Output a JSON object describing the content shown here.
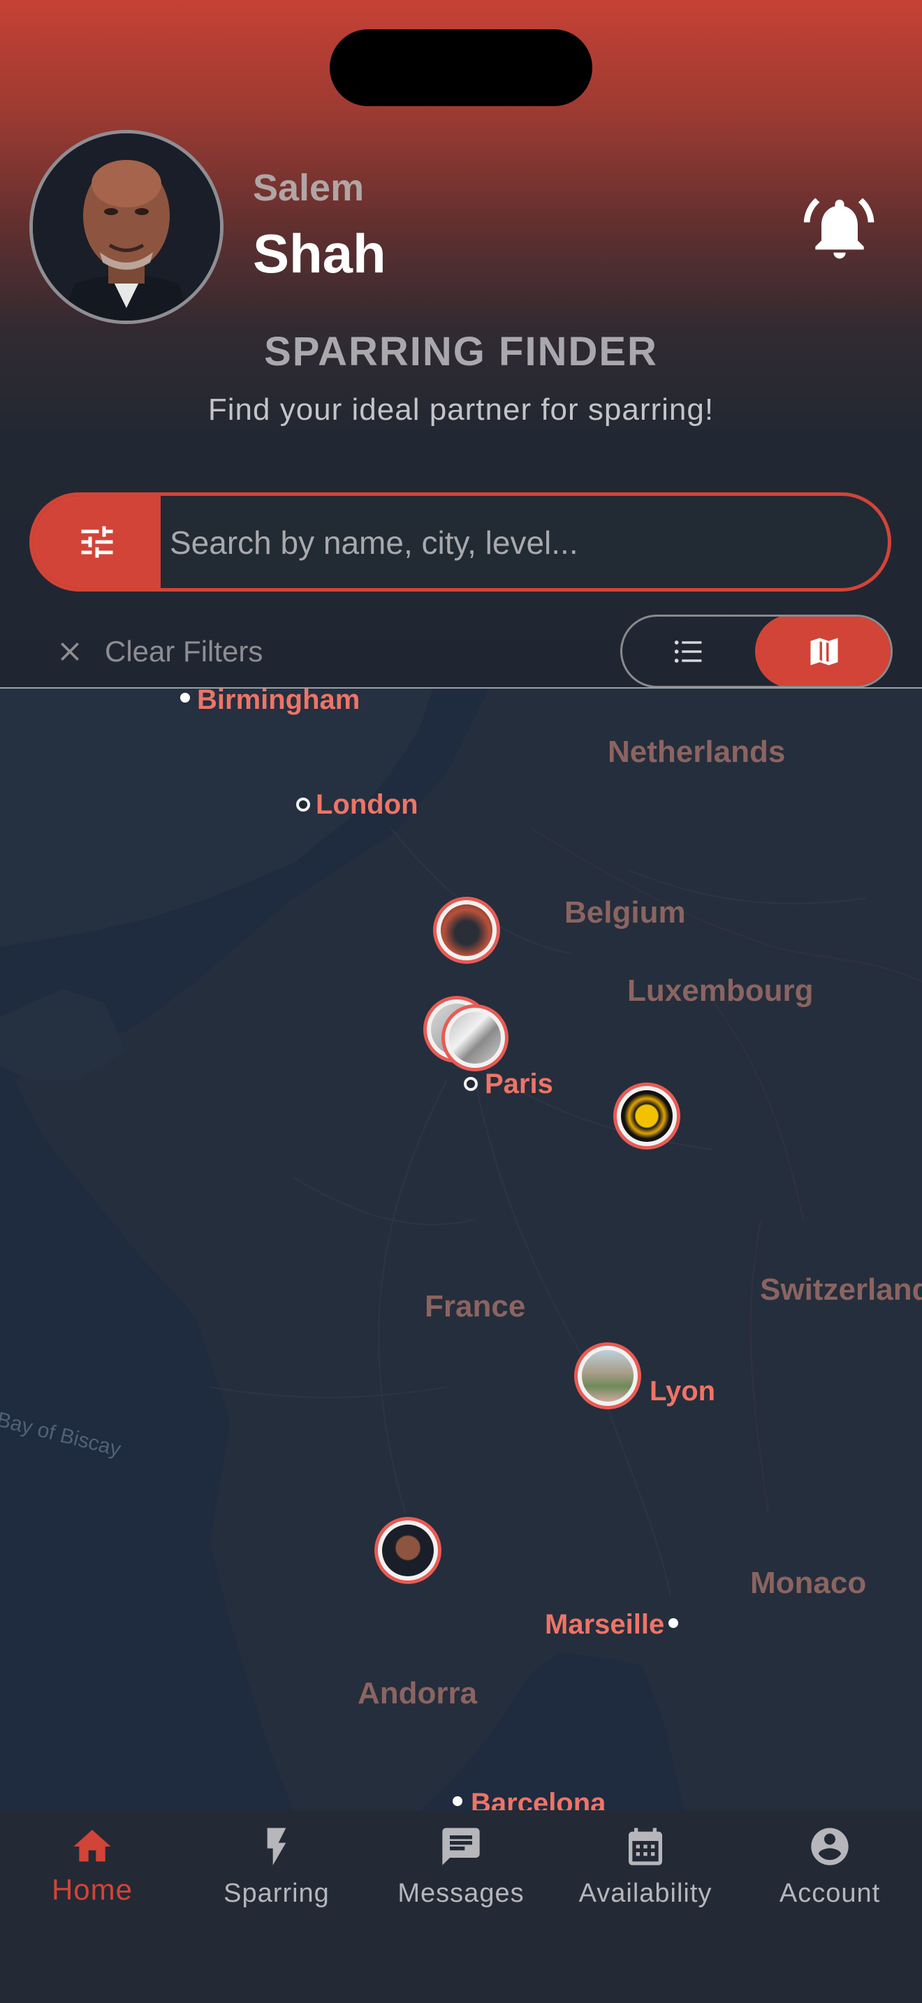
{
  "user": {
    "first_name": "Salem",
    "last_name": "Shah"
  },
  "page": {
    "title": "SPARRING FINDER",
    "subtitle": "Find your ideal partner for sparring!"
  },
  "search": {
    "placeholder": "Search by name, city, level...",
    "value": ""
  },
  "filters": {
    "clear_label": "Clear Filters"
  },
  "view_toggle": {
    "options": [
      "list",
      "map"
    ],
    "selected": "map"
  },
  "map": {
    "countries": [
      "Netherlands",
      "Belgium",
      "Luxembourg",
      "France",
      "Switzerland",
      "Monaco",
      "Andorra"
    ],
    "cities": [
      "Birmingham",
      "London",
      "Paris",
      "Lyon",
      "Marseille",
      "Barcelona"
    ],
    "water": [
      "Bay of Biscay"
    ]
  },
  "nav": {
    "items": [
      {
        "label": "Home",
        "icon": "home-icon",
        "active": true
      },
      {
        "label": "Sparring",
        "icon": "lightning-icon",
        "active": false
      },
      {
        "label": "Messages",
        "icon": "message-icon",
        "active": false
      },
      {
        "label": "Availability",
        "icon": "calendar-icon",
        "active": false
      },
      {
        "label": "Account",
        "icon": "account-icon",
        "active": false
      }
    ]
  },
  "colors": {
    "accent": "#d24437",
    "background": "#202631",
    "map_bg": "#1e2a3d"
  }
}
